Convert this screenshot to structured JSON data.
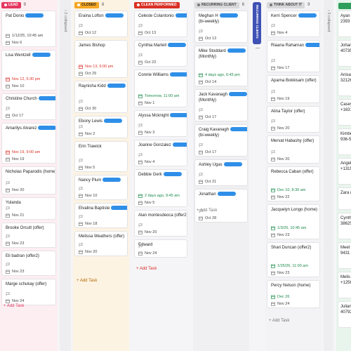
{
  "colors": {
    "lead": "#e4385f",
    "closed": "#f5a623",
    "clean_performed": "#d93025",
    "recurring_client": "#757575",
    "think_about_it": "#7a7a7a",
    "recurring_clients_collapsed": "#3f51b5",
    "date_red": "#d93025",
    "date_green": "#1a8a4a",
    "redaction": "#2f8fe8"
  },
  "board": {
    "collapsed_left": {
      "label": "2 collapsed"
    },
    "collapsed_right": {
      "label": "3 collapsed"
    },
    "recurring_clients_tab": {
      "label": "RECURRING CLIENTS",
      "count": "1",
      "extra": "—"
    },
    "columns": [
      {
        "name": "LEAD",
        "count": "9",
        "add_label": "+ Add Task",
        "cards": [
          {
            "title": "Pat Donio",
            "date": "1/12/25, 10:45 am",
            "date2": "Nov 6",
            "redacted": true
          },
          {
            "title": "Lisa Wentzell",
            "date": "Nov 12, 5:30 pm",
            "date_red": true,
            "date2": "Nov 10",
            "redacted": true
          },
          {
            "title": "Christine Church",
            "date": "Oct 17",
            "redacted": true
          },
          {
            "title": "Amarilys Alvarez",
            "date": "Nov 19, 9:00 am",
            "date_red": true,
            "date2": "Nov 19",
            "redacted": true
          },
          {
            "title": "Nicholas Paparodis (home)",
            "date": "Nov 20"
          },
          {
            "title": "Yulanda",
            "date": "Nov 21"
          },
          {
            "title": "Brooke Orcutt (offer)",
            "date": "Nov 23"
          },
          {
            "title": "Eli badran (offer2)",
            "date": "Nov 23"
          },
          {
            "title": "Marge schukay (offer)",
            "date": "Nov 24"
          }
        ]
      },
      {
        "name": "CLOSED",
        "count": "8",
        "add_label": "+ Add Task",
        "cards": [
          {
            "title": "Eraina Lofton",
            "date": "Oct 12",
            "redacted": true
          },
          {
            "title": "James Bishop",
            "date": "Nov 13, 6:00 pm",
            "date_red": true,
            "date2": "Oct 29"
          },
          {
            "title": "Raynisha Kidd",
            "date": "Oct 30",
            "redacted": true
          },
          {
            "title": "Ebony Lewis",
            "date": "Nov 2",
            "redacted": true
          },
          {
            "title": "Erin Trawick",
            "date": "Nov 5"
          },
          {
            "title": "Nancy Plum",
            "date": "Nov 10",
            "redacted": true
          },
          {
            "title": "Elvalina Baptiste",
            "date": "Nov 18",
            "redacted": true
          },
          {
            "title": "Melissa Weathers (offer)",
            "date": "Nov 20"
          }
        ]
      },
      {
        "name": "CLEAN PERFORMED",
        "count": "",
        "add_label": "+ Add Task",
        "cards": [
          {
            "title": "Celeste Colantonio",
            "date": "Oct 13",
            "redacted": true
          },
          {
            "title": "Cynthia Martell",
            "date": "Oct 23",
            "redacted": true
          },
          {
            "title": "Connie Williams",
            "date": "Tomorrow, 11:00 am",
            "date_green": true,
            "date2": "Nov 1",
            "redacted": true
          },
          {
            "title": "Alyssa Mcknight",
            "date": "Nov 3",
            "redacted": true
          },
          {
            "title": "Joanne Gonzalez",
            "date": "Nov 4",
            "redacted": true
          },
          {
            "title": "Debbie Gerk",
            "date": "2 days ago, 9:45 am",
            "date_green": true,
            "date2": "Nov 5",
            "redacted": true
          },
          {
            "title": "Alan montesdeoca (offer2)",
            "date": "Nov 20"
          },
          {
            "title": "Edward",
            "date": "Nov 24"
          }
        ]
      },
      {
        "name": "RECURRING CLIENT",
        "count": "6",
        "add_label": "+ Add Task",
        "cards": [
          {
            "title": "Meghan H",
            "subtitle": "(bi-weekly)",
            "date": "Oct 13",
            "redacted": true
          },
          {
            "title": "Mike Stoddard",
            "subtitle": "(Monthly)",
            "date": "4 days ago, 6:45 pm",
            "date_green": true,
            "date2": "Oct 14",
            "redacted": true
          },
          {
            "title": "Jack Kavanagh",
            "subtitle": "(Monthly)",
            "date": "Oct 17",
            "redacted": true
          },
          {
            "title": "Craig Kavanagh",
            "subtitle": "(bi-weekly)",
            "date": "Oct 17",
            "redacted": true
          },
          {
            "title": "Ashley Ugas",
            "date": "Oct 21",
            "redacted": true
          },
          {
            "title": "Jonathan",
            "date": "Oct 28",
            "redacted": true
          }
        ]
      },
      {
        "name": "THINK ABOUT IT",
        "count": "9",
        "add_label": "+ Add Task",
        "cards": [
          {
            "title": "Kerri Spencer",
            "date": "Nov 4",
            "redacted": true
          },
          {
            "title": "Riaana Raharnan",
            "date": "Nov 17",
            "redacted": true
          },
          {
            "title": "Aparna Bokkisam (offer)",
            "date": "Nov 19"
          },
          {
            "title": "Alina Taylor (offer)",
            "date": "Nov 20"
          },
          {
            "title": "Mervat Habashy (offer)",
            "date": "Nov 20"
          },
          {
            "title": "Rebecca Caban (offer)",
            "date": "Dec 10, 8:30 am",
            "date_green": true,
            "date2": "Nov 22"
          },
          {
            "title": "Jacquelyn Longo (home)",
            "date": "1/3/26, 10:45 am",
            "date_green": true,
            "date2": "Nov 23"
          },
          {
            "title": "Shari Duncan (offer2)",
            "date": "1/25/26, 11:00 am",
            "date_green": true,
            "date2": "Nov 23"
          },
          {
            "title": "Percy Nelson (home)",
            "date": "Dec 26",
            "date_green": true,
            "date2": "Nov 24"
          }
        ]
      }
    ],
    "partial_column": {
      "cards": [
        {
          "title": "Ayan",
          "line2": "2393"
        },
        {
          "title": "Johan",
          "line2": "40735"
        },
        {
          "title": "Anisa",
          "line2": "32126"
        },
        {
          "title": "Casey",
          "line2": "+1631"
        },
        {
          "title": "Kimbe",
          "line2": "936-5"
        },
        {
          "title": "Angel",
          "line2": "+1315"
        },
        {
          "title": "Zara ("
        },
        {
          "title": "Cynth",
          "line2": "38625"
        },
        {
          "title": "Meet",
          "line2": "9431"
        },
        {
          "title": "Melis",
          "line2": "+1256"
        },
        {
          "title": "Julian",
          "line2": "40792"
        }
      ]
    }
  }
}
